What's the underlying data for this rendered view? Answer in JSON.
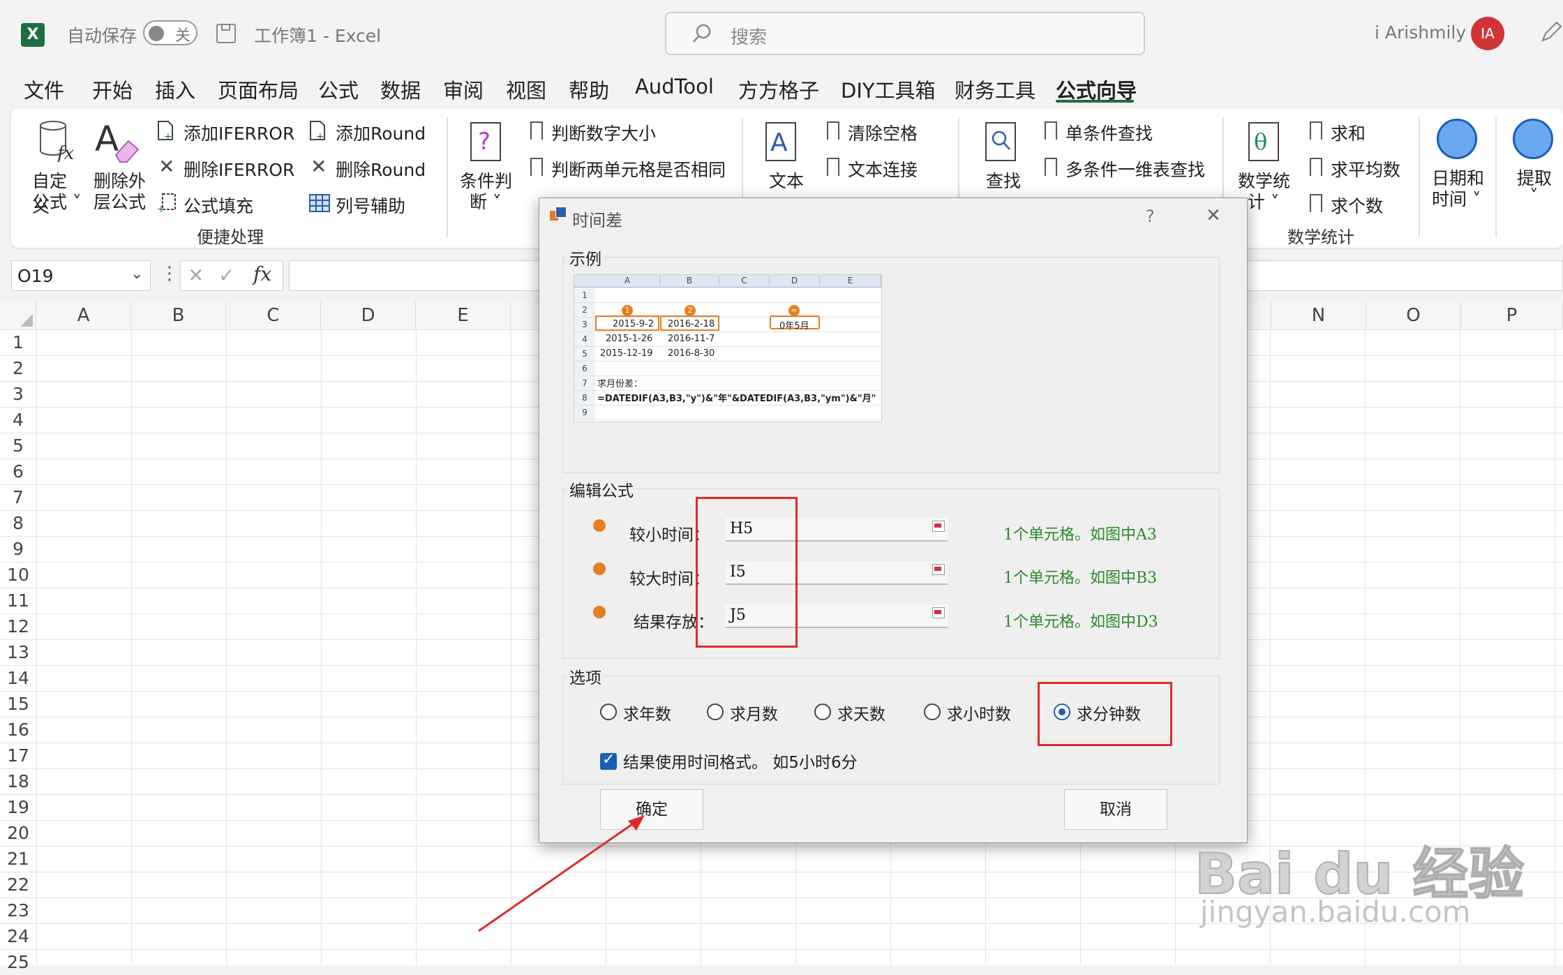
{
  "titlebar": {
    "autosave_label": "自动保存",
    "autosave_state": "关",
    "doc_title": "工作簿1  -  Excel",
    "search_placeholder": "搜索",
    "user_name": "i Arishmily",
    "avatar_initials": "IA"
  },
  "menu": {
    "tabs": [
      "文件",
      "开始",
      "插入",
      "页面布局",
      "公式",
      "数据",
      "审阅",
      "视图",
      "帮助",
      "AudTool",
      "方方格子",
      "DIY工具箱",
      "财务工具",
      "公式向导"
    ],
    "active": "公式向导"
  },
  "ribbon": {
    "custom_formula": [
      "自定义",
      "公式 ˅"
    ],
    "delete_outer": [
      "删除外",
      "层公式"
    ],
    "add_iferror": "添加IFERROR",
    "del_iferror": "删除IFERROR",
    "formula_fill": "公式填充",
    "add_round": "添加Round",
    "del_round": "删除Round",
    "col_helper": "列号辅助",
    "group_quick": "便捷处理",
    "cond_judge": [
      "条件判",
      "断 ˅"
    ],
    "judge_num": "判断数字大小",
    "judge_cells": "判断两单元格是否相同",
    "text": [
      "文本",
      "˅"
    ],
    "clear_space": "清除空格",
    "text_concat": "文本连接",
    "lookup": [
      "查找",
      "˅"
    ],
    "single_lookup": "单条件查找",
    "multi_lookup": "多条件一维表查找",
    "math_stats": [
      "数学统",
      "计 ˅"
    ],
    "sum": "求和",
    "avg_sq": "求平均数",
    "count": "求个数",
    "group_math": "数学统计",
    "datetime": [
      "日期和",
      "时间 ˅"
    ],
    "extract": [
      "提取",
      "˅"
    ]
  },
  "formula_bar": {
    "name_box": "O19",
    "fx": "fx"
  },
  "sheet": {
    "columns_left": [
      "A",
      "B",
      "C",
      "D",
      "E"
    ],
    "columns_right": [
      "N",
      "O",
      "P"
    ],
    "rows": [
      "1",
      "2",
      "3",
      "4",
      "5",
      "6",
      "7",
      "8",
      "9",
      "10",
      "11",
      "12",
      "13",
      "14",
      "15",
      "16",
      "17",
      "18",
      "19",
      "20",
      "21",
      "22",
      "23",
      "24",
      "25"
    ]
  },
  "dialog": {
    "title": "时间差",
    "help": "?",
    "close": "✕",
    "example_legend": "示例",
    "example": {
      "cols": [
        "A",
        "B",
        "C",
        "D",
        "E"
      ],
      "rows": [
        "1",
        "2",
        "3",
        "4",
        "5",
        "6",
        "7",
        "8",
        "9"
      ],
      "a3": "2015-9-2",
      "b3": "2016-2-18",
      "d3": "0年5月",
      "a4": "2015-1-26",
      "b4": "2016-11-7",
      "a5": "2015-12-19",
      "b5": "2016-8-30",
      "a7": "求月份差：",
      "a8": "=DATEDIF(A3,B3,\"y\")&\"年\"&DATEDIF(A3,B3,\"ym\")&\"月\"",
      "markers": [
        "1",
        "2",
        "="
      ]
    },
    "edit_legend": "编辑公式",
    "fields": [
      {
        "label": "较小时间：",
        "value": "H5",
        "hint": "1个单元格。如图中A3"
      },
      {
        "label": "较大时间：",
        "value": "I5",
        "hint": "1个单元格。如图中B3"
      },
      {
        "label": "结果存放：",
        "value": "J5",
        "hint": "1个单元格。如图中D3"
      }
    ],
    "options_legend": "选项",
    "radios": [
      "求年数",
      "求月数",
      "求天数",
      "求小时数",
      "求分钟数"
    ],
    "selected_radio": "求分钟数",
    "checkbox_label": "结果使用时间格式。  如5小时6分",
    "checkbox_checked": true,
    "ok": "确定",
    "cancel": "取消"
  },
  "watermark": {
    "brand": "Bai du 经验",
    "url": "jingyan.baidu.com"
  },
  "colors": {
    "excel_green": "#1d6f42",
    "accent_blue": "#1a5fb4",
    "annotation_red": "#e02a2a",
    "hint_green": "#2a8a2a"
  }
}
